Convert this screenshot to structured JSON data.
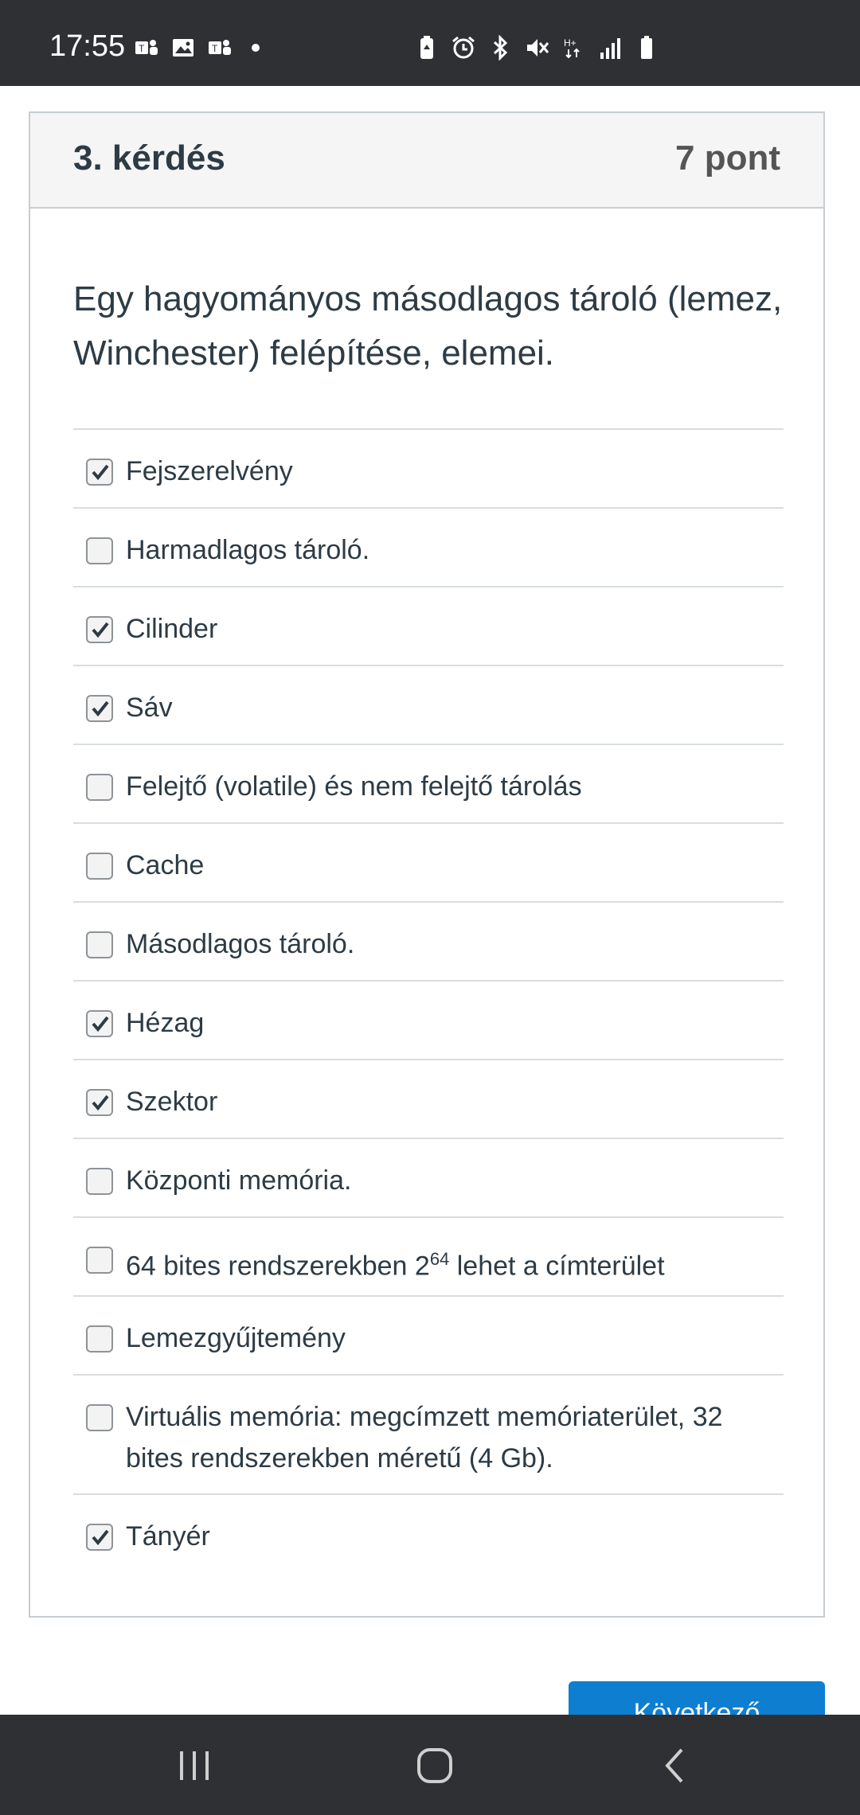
{
  "status_bar": {
    "time": "17:55",
    "left_icons": [
      "teams-icon",
      "gallery-icon",
      "teams-icon",
      "dot"
    ],
    "right_icons": [
      "battery-saver-icon",
      "alarm-icon",
      "bluetooth-icon",
      "mute-icon",
      "data-hplus-icon",
      "signal-icon",
      "battery-icon"
    ]
  },
  "question": {
    "title": "3. kérdés",
    "points": "7 pont",
    "text": "Egy hagyományos másodlagos tároló (lemez, Winchester) felépítése, elemei."
  },
  "answers": [
    {
      "label": "Fejszerelvény",
      "checked": true
    },
    {
      "label": "Harmadlagos tároló.",
      "checked": false
    },
    {
      "label": "Cilinder",
      "checked": true
    },
    {
      "label": "Sáv",
      "checked": true
    },
    {
      "label": "Felejtő (volatile) és nem felejtő tárolás",
      "checked": false
    },
    {
      "label": "Cache",
      "checked": false
    },
    {
      "label": "Másodlagos tároló.",
      "checked": false
    },
    {
      "label": "Hézag",
      "checked": true
    },
    {
      "label": "Szektor",
      "checked": true
    },
    {
      "label": "Központi memória.",
      "checked": false
    },
    {
      "label_before": "64 bites rendszerekben 2",
      "label_sup": "64",
      "label_after": " lehet a címterület",
      "checked": false
    },
    {
      "label": "Lemezgyűjtemény",
      "checked": false
    },
    {
      "label": "Virtuális memória: megcímzett memóriaterület, 32 bites rendszerekben  méretű (4 Gb).",
      "checked": false
    },
    {
      "label": "Tányér",
      "checked": true
    }
  ],
  "next_button": {
    "label": "Következő"
  },
  "colors": {
    "status_bar": "#2f3033",
    "accent": "#0e7ed1",
    "text": "#2d3b45"
  }
}
